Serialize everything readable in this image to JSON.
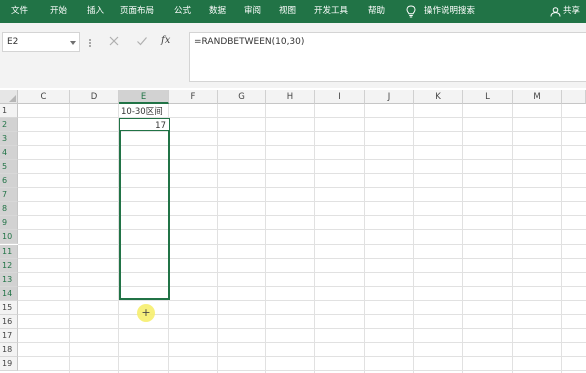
{
  "ribbon": {
    "tabs": [
      "文件",
      "开始",
      "插入",
      "页面布局",
      "公式",
      "数据",
      "审阅",
      "视图",
      "开发工具",
      "帮助"
    ],
    "tell_me": "操作说明搜索",
    "share": "共享",
    "bg_color": "#217346"
  },
  "formula_bar": {
    "name_box": "E2",
    "fx_label": "fx",
    "formula": "=RANDBETWEEN(10,30)"
  },
  "grid": {
    "columns": [
      "C",
      "D",
      "E",
      "F",
      "G",
      "H",
      "I",
      "J",
      "K",
      "L",
      "M"
    ],
    "rows": [
      "1",
      "2",
      "3",
      "4",
      "5",
      "6",
      "7",
      "8",
      "9",
      "10",
      "11",
      "12",
      "13",
      "14",
      "15",
      "16",
      "17",
      "18",
      "19"
    ],
    "selected_column": "E",
    "cells": {
      "E1": "10-30区间",
      "E2": "17"
    },
    "selection_color": "#217346"
  },
  "cursor": {
    "symbol": "+"
  }
}
